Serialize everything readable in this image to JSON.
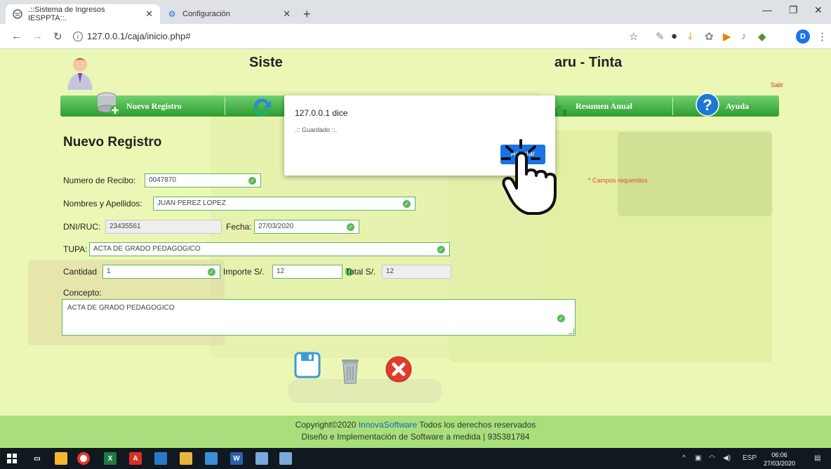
{
  "browser": {
    "tabs": [
      {
        "label": ".::Sistema de Ingresos IESPPTA::.",
        "active": true
      },
      {
        "label": "Configuración",
        "active": false
      }
    ],
    "url": "127.0.0.1/caja/inicio.php#",
    "profile_initial": "D"
  },
  "header": {
    "title_left": "Siste",
    "title_right": "aru - Tinta",
    "logout": "Salir"
  },
  "menu": [
    {
      "label": "Nuevo Registro",
      "icon": "database-add-icon"
    },
    {
      "label": "",
      "icon": "refresh-icon"
    },
    {
      "label": "Resumen Anual",
      "icon": "chart-icon"
    },
    {
      "label": "Ayuda",
      "icon": "help-icon"
    }
  ],
  "form": {
    "title": "Nuevo Registro",
    "required_note": "* Campos requeridos",
    "recibo": {
      "label": "Numero de Recibo:",
      "value": "0047870"
    },
    "nombres": {
      "label": "Nombres y Apellidos:",
      "value": "JUAN PEREZ LOPEZ"
    },
    "dni": {
      "label": "DNI/RUC:",
      "value": "23435561"
    },
    "fecha": {
      "label": "Fecha:",
      "value": "27/03/2020"
    },
    "tupa": {
      "label": "TUPA:",
      "value": "ACTA DE GRADO PEDAGOGICO"
    },
    "cantidad": {
      "label": "Cantidad",
      "value": "1"
    },
    "importe": {
      "label": "Importe S/.",
      "value": "12"
    },
    "total": {
      "label": "Total S/.",
      "value": "12"
    },
    "concepto": {
      "label": "Concepto:",
      "value": "ACTA DE GRADO PEDAGOGICO"
    }
  },
  "footer": {
    "line1_prefix": "Copyright©2020 ",
    "brand": "InnovaSoftware",
    "line1_suffix": " Todos los derechos reservados",
    "line2": "Diseño e Implementación de Software a medida | 935381784"
  },
  "dialog": {
    "title": "127.0.0.1 dice",
    "message": ".:: Guardado ::.",
    "button": "Aceptar"
  },
  "taskbar": {
    "language": "ESP",
    "time": "06:06",
    "date": "27/03/2020"
  },
  "colors": {
    "page_bg": "#edf7b5",
    "menu_green": "#2f9c2f",
    "field_border": "#5cb85c",
    "accent_blue": "#1a73e8",
    "footer_bg": "#a8df7a"
  }
}
